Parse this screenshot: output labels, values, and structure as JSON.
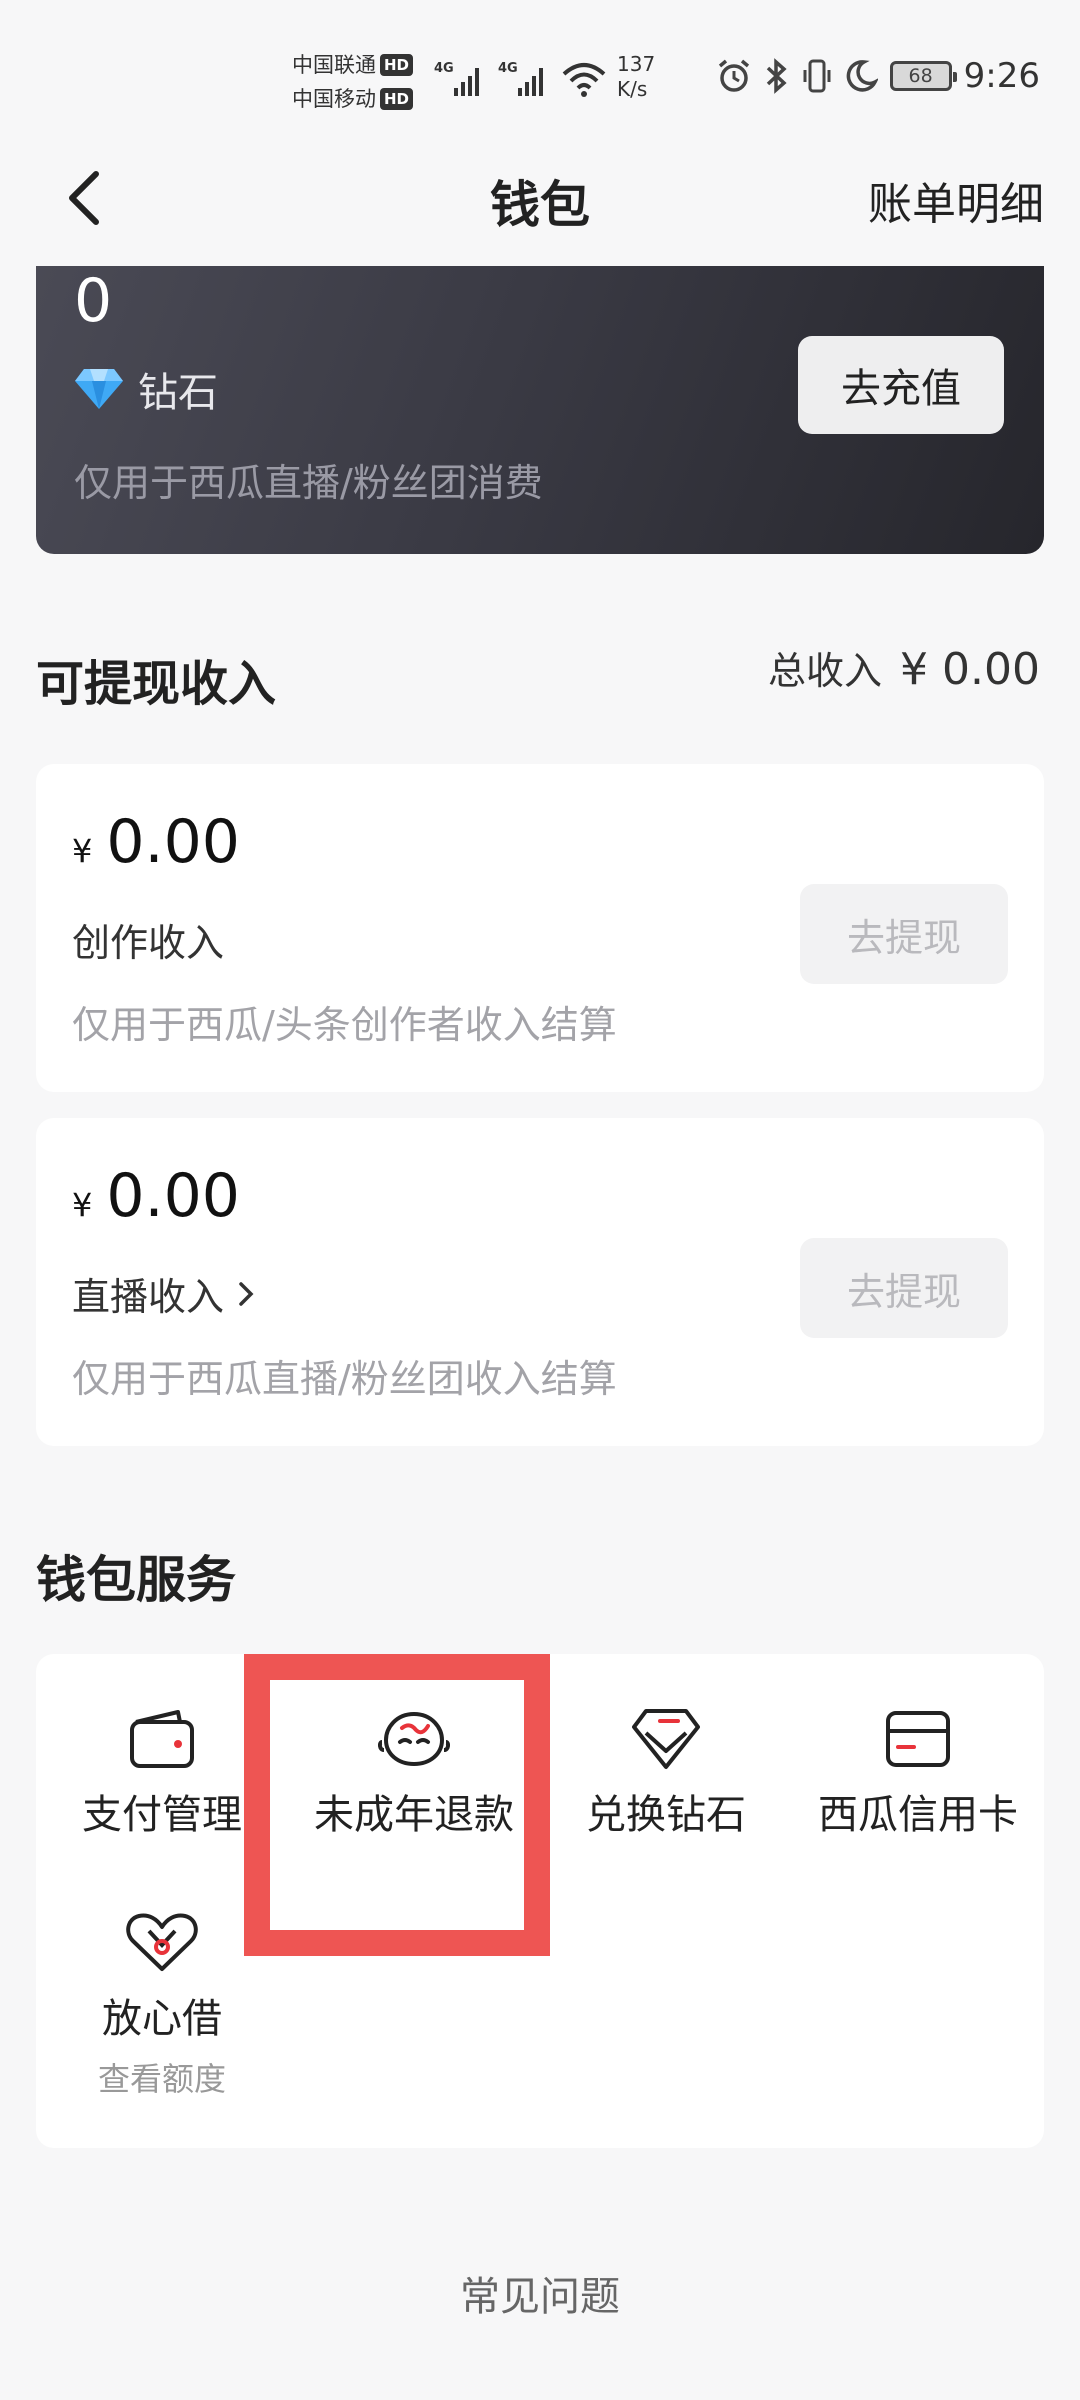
{
  "status_bar": {
    "carrier_1": "中国联通",
    "carrier_2": "中国移动",
    "hd": "HD",
    "network": "4G",
    "speed_value": "137",
    "speed_unit": "K/s",
    "battery": "68",
    "time": "9:26"
  },
  "nav": {
    "title": "钱包",
    "right_link": "账单明细"
  },
  "diamond_card": {
    "amount": "0",
    "label": "钻石",
    "note": "仅用于西瓜直播/粉丝团消费",
    "button": "去充值"
  },
  "income": {
    "title": "可提现收入",
    "total_label": "总收入",
    "total_amount": "¥ 0.00",
    "cards": [
      {
        "currency": "¥",
        "amount": "0.00",
        "label": "创作收入",
        "note": "仅用于西瓜/头条创作者收入结算",
        "button": "去提现"
      },
      {
        "currency": "¥",
        "amount": "0.00",
        "label": "直播收入",
        "note": "仅用于西瓜直播/粉丝团收入结算",
        "button": "去提现"
      }
    ]
  },
  "services": {
    "title": "钱包服务",
    "items": [
      {
        "name": "支付管理",
        "icon": "wallet-icon"
      },
      {
        "name": "未成年退款",
        "icon": "child-face-icon"
      },
      {
        "name": "兑换钻石",
        "icon": "diamond-exchange-icon"
      },
      {
        "name": "西瓜信用卡",
        "icon": "credit-card-icon"
      },
      {
        "name": "放心借",
        "sub": "查看额度",
        "icon": "heart-loan-icon"
      }
    ]
  },
  "faq": "常见问题",
  "colors": {
    "highlight": "#ee5553",
    "accent_red": "#e8333a",
    "card_dark": "#3a3a44"
  }
}
